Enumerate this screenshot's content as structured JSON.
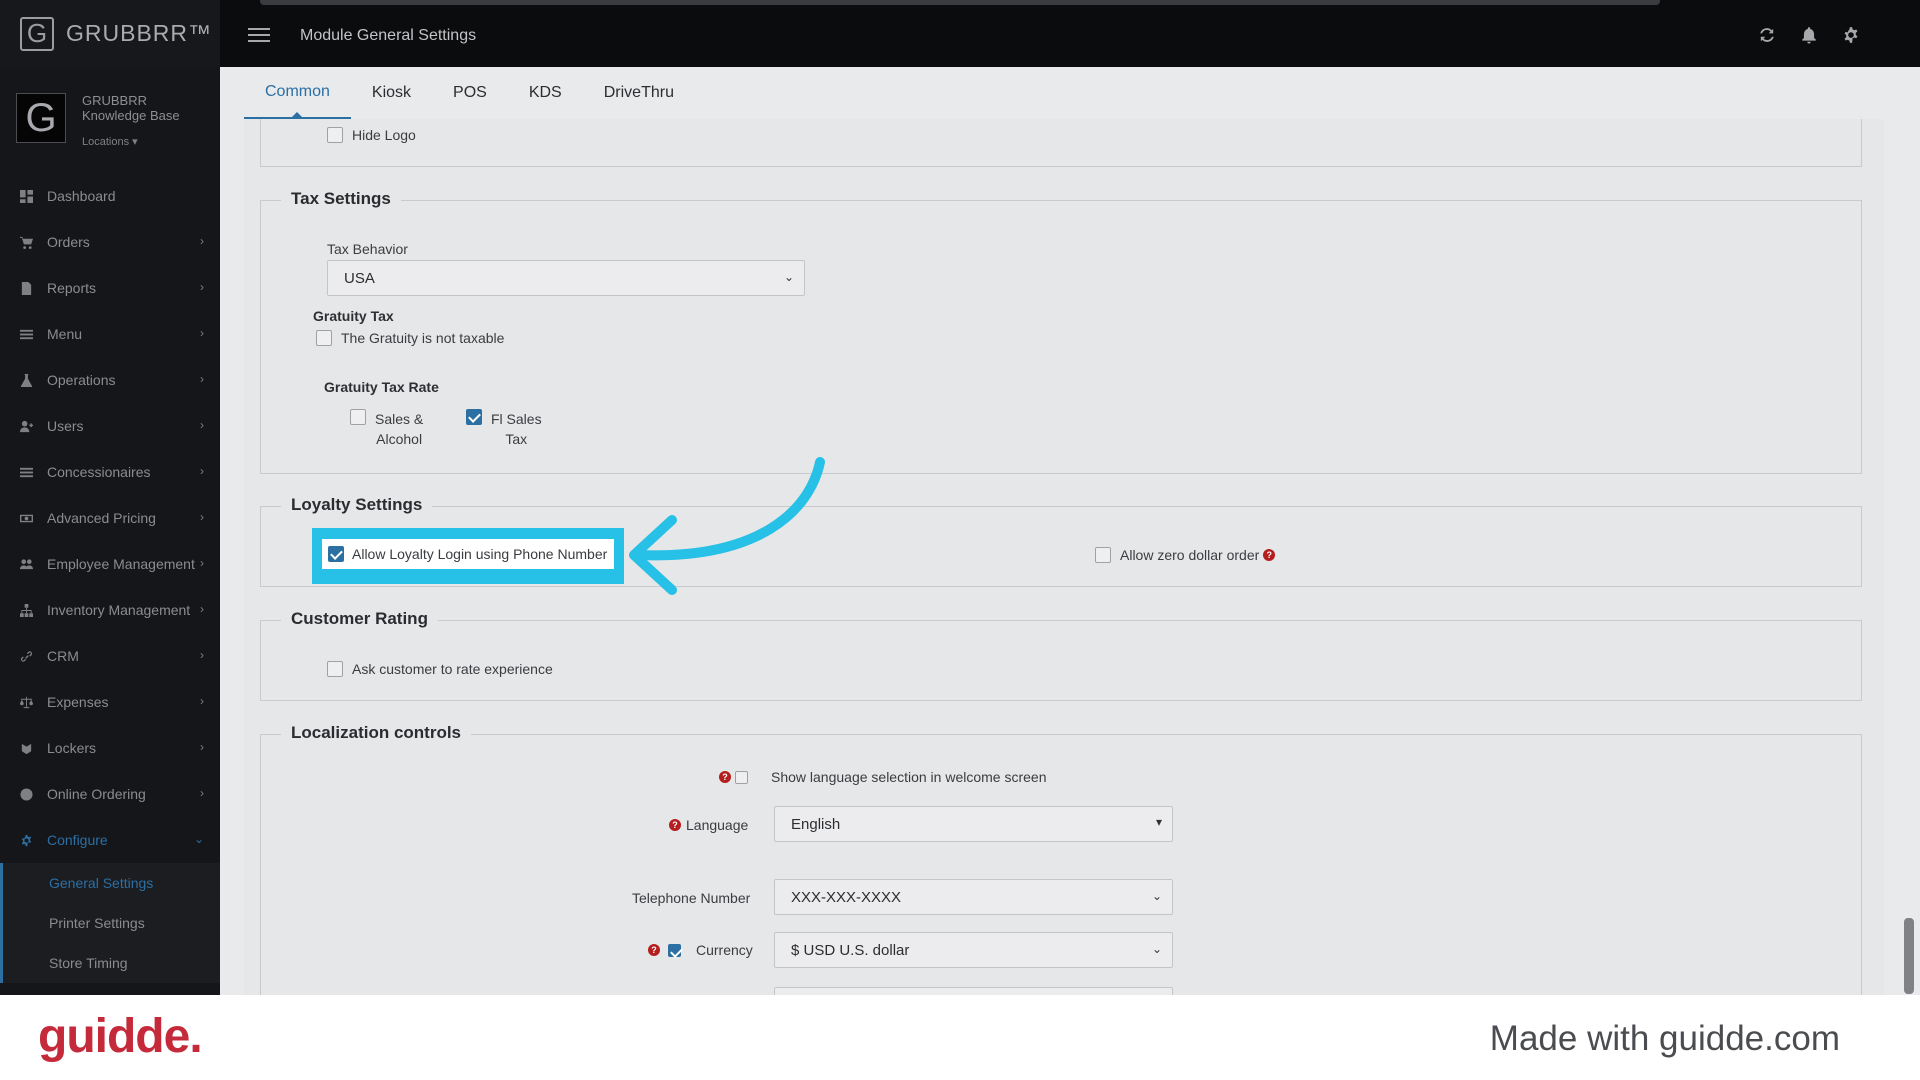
{
  "topbar": {
    "brand": "GRUBBRR™",
    "title": "Module General Settings",
    "icons": [
      "refresh-icon",
      "bell-icon",
      "gear-icon"
    ]
  },
  "store": {
    "name_line1": "GRUBBRR",
    "name_line2": "Knowledge Base",
    "locations": "Locations"
  },
  "sidebar": {
    "items": [
      {
        "label": "Dashboard",
        "icon": "dashboard-icon"
      },
      {
        "label": "Orders",
        "icon": "cart-icon"
      },
      {
        "label": "Reports",
        "icon": "report-icon"
      },
      {
        "label": "Menu",
        "icon": "list-icon"
      },
      {
        "label": "Operations",
        "icon": "flask-icon"
      },
      {
        "label": "Users",
        "icon": "user-icon"
      },
      {
        "label": "Concessionaires",
        "icon": "list-icon"
      },
      {
        "label": "Advanced Pricing",
        "icon": "money-icon"
      },
      {
        "label": "Employee Management",
        "icon": "users-icon"
      },
      {
        "label": "Inventory Management",
        "icon": "sitemap-icon"
      },
      {
        "label": "CRM",
        "icon": "link-icon"
      },
      {
        "label": "Expenses",
        "icon": "scale-icon"
      },
      {
        "label": "Lockers",
        "icon": "lockers-icon"
      },
      {
        "label": "Online Ordering",
        "icon": "globe-icon"
      },
      {
        "label": "Configure",
        "icon": "gear-icon"
      }
    ],
    "sub_items": [
      "General Settings",
      "Printer Settings",
      "Store Timing"
    ]
  },
  "tabs": [
    "Common",
    "Kiosk",
    "POS",
    "KDS",
    "DriveThru"
  ],
  "sections": {
    "top": {
      "hide_logo": "Hide Logo"
    },
    "tax": {
      "title": "Tax Settings",
      "behavior_label": "Tax Behavior",
      "behavior_value": "USA",
      "gratuity_tax": "Gratuity Tax",
      "gratuity_not_taxable": "The Gratuity is not taxable",
      "gratuity_rate": "Gratuity Tax Rate",
      "rate_option1_line1": "Sales &",
      "rate_option1_line2": "Alcohol",
      "rate_option2_line1": "Fl Sales",
      "rate_option2_line2": "Tax"
    },
    "loyalty": {
      "title": "Loyalty Settings",
      "phone_login": "Allow Loyalty Login using Phone Number",
      "zero_dollar": "Allow zero dollar order"
    },
    "rating": {
      "title": "Customer Rating",
      "ask": "Ask customer to rate experience"
    },
    "localization": {
      "title": "Localization controls",
      "show_language": "Show language selection in welcome screen",
      "language_label": "Language",
      "language_value": "English",
      "telephone_label": "Telephone Number",
      "telephone_value": "XXX-XXX-XXXX",
      "currency_label": "Currency",
      "currency_value": "$ USD U.S. dollar"
    }
  },
  "footer": {
    "logo": "guidde.",
    "made_with": "Made with guidde.com"
  },
  "colors": {
    "accent": "#2c6fa3",
    "highlight": "#27c0e6",
    "guidde": "#c42a3a"
  }
}
